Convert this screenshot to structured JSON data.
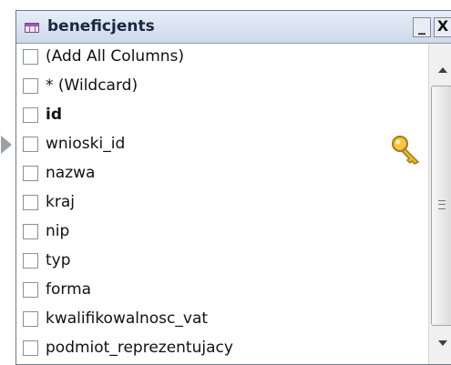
{
  "window": {
    "title": "beneficjents",
    "minimize_label": "_",
    "close_label": "X"
  },
  "columns": [
    {
      "label": "(Add All Columns)",
      "checked": false,
      "primary_key": false
    },
    {
      "label": "* (Wildcard)",
      "checked": false,
      "primary_key": false
    },
    {
      "label": "id",
      "checked": false,
      "primary_key": true
    },
    {
      "label": "wnioski_id",
      "checked": false,
      "primary_key": false
    },
    {
      "label": "nazwa",
      "checked": false,
      "primary_key": false
    },
    {
      "label": "kraj",
      "checked": false,
      "primary_key": false
    },
    {
      "label": "nip",
      "checked": false,
      "primary_key": false
    },
    {
      "label": "typ",
      "checked": false,
      "primary_key": false
    },
    {
      "label": "forma",
      "checked": false,
      "primary_key": false
    },
    {
      "label": "kwalifikowalnosc_vat",
      "checked": false,
      "primary_key": false
    },
    {
      "label": "podmiot_reprezentujacy",
      "checked": false,
      "primary_key": false
    }
  ],
  "icons": {
    "title": "table-icon",
    "primary_key": "key-icon",
    "row_marker": "current-row-arrow-icon"
  }
}
